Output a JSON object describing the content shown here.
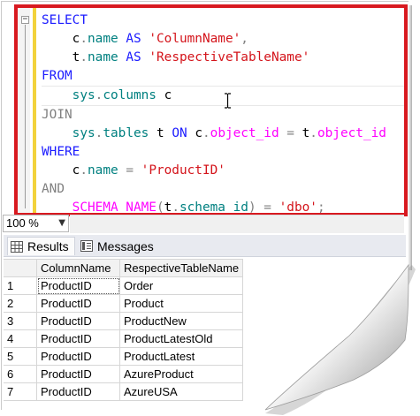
{
  "editor": {
    "lines": [
      [
        {
          "t": "SELECT",
          "c": "kw"
        }
      ],
      [
        {
          "t": "    c",
          "c": "plain"
        },
        {
          "t": ".",
          "c": "gkw"
        },
        {
          "t": "name ",
          "c": "obj"
        },
        {
          "t": "AS ",
          "c": "kw"
        },
        {
          "t": "'ColumnName'",
          "c": "str"
        },
        {
          "t": ",",
          "c": "gkw"
        }
      ],
      [
        {
          "t": "    t",
          "c": "plain"
        },
        {
          "t": ".",
          "c": "gkw"
        },
        {
          "t": "name ",
          "c": "obj"
        },
        {
          "t": "AS ",
          "c": "kw"
        },
        {
          "t": "'RespectiveTableName'",
          "c": "str"
        }
      ],
      [
        {
          "t": "FROM",
          "c": "kw"
        }
      ],
      [
        {
          "t": "    sys",
          "c": "obj"
        },
        {
          "t": ".",
          "c": "gkw"
        },
        {
          "t": "columns ",
          "c": "obj"
        },
        {
          "t": "c",
          "c": "plain"
        }
      ],
      [
        {
          "t": "JOIN",
          "c": "gkw"
        }
      ],
      [
        {
          "t": "    sys",
          "c": "obj"
        },
        {
          "t": ".",
          "c": "gkw"
        },
        {
          "t": "tables ",
          "c": "obj"
        },
        {
          "t": "t ",
          "c": "plain"
        },
        {
          "t": "ON ",
          "c": "kw"
        },
        {
          "t": "c",
          "c": "plain"
        },
        {
          "t": ".",
          "c": "gkw"
        },
        {
          "t": "object_id ",
          "c": "fn"
        },
        {
          "t": "= ",
          "c": "gkw"
        },
        {
          "t": "t",
          "c": "plain"
        },
        {
          "t": ".",
          "c": "gkw"
        },
        {
          "t": "object_id",
          "c": "fn"
        }
      ],
      [
        {
          "t": "WHERE",
          "c": "kw"
        }
      ],
      [
        {
          "t": "    c",
          "c": "plain"
        },
        {
          "t": ".",
          "c": "gkw"
        },
        {
          "t": "name ",
          "c": "obj"
        },
        {
          "t": "= ",
          "c": "gkw"
        },
        {
          "t": "'ProductID'",
          "c": "str"
        }
      ],
      [
        {
          "t": "AND",
          "c": "gkw"
        }
      ],
      [
        {
          "t": "    SCHEMA_NAME",
          "c": "fn"
        },
        {
          "t": "(",
          "c": "gkw"
        },
        {
          "t": "t",
          "c": "plain"
        },
        {
          "t": ".",
          "c": "gkw"
        },
        {
          "t": "schema_id",
          "c": "obj"
        },
        {
          "t": ") = ",
          "c": "gkw"
        },
        {
          "t": "'dbo'",
          "c": "str"
        },
        {
          "t": ";",
          "c": "gkw"
        }
      ]
    ],
    "collapse_symbol": "−"
  },
  "zoom": {
    "value": "100 %",
    "arrow": "▼"
  },
  "tabs": {
    "results_label": "Results",
    "messages_label": "Messages"
  },
  "grid": {
    "headers": [
      "ColumnName",
      "RespectiveTableName"
    ],
    "rows": [
      {
        "n": "1",
        "col": "ProductID",
        "table": "Order"
      },
      {
        "n": "2",
        "col": "ProductID",
        "table": "Product"
      },
      {
        "n": "3",
        "col": "ProductID",
        "table": "ProductNew"
      },
      {
        "n": "4",
        "col": "ProductID",
        "table": "ProductLatestOld"
      },
      {
        "n": "5",
        "col": "ProductID",
        "table": "ProductLatest"
      },
      {
        "n": "6",
        "col": "ProductID",
        "table": "AzureProduct"
      },
      {
        "n": "7",
        "col": "ProductID",
        "table": "AzureUSA"
      }
    ]
  },
  "colors": {
    "highlight_border": "#d81920",
    "keyword": "#1c1cff",
    "string": "#d4141b",
    "function": "#ff00ff",
    "object": "#008080",
    "operator": "#808080"
  }
}
